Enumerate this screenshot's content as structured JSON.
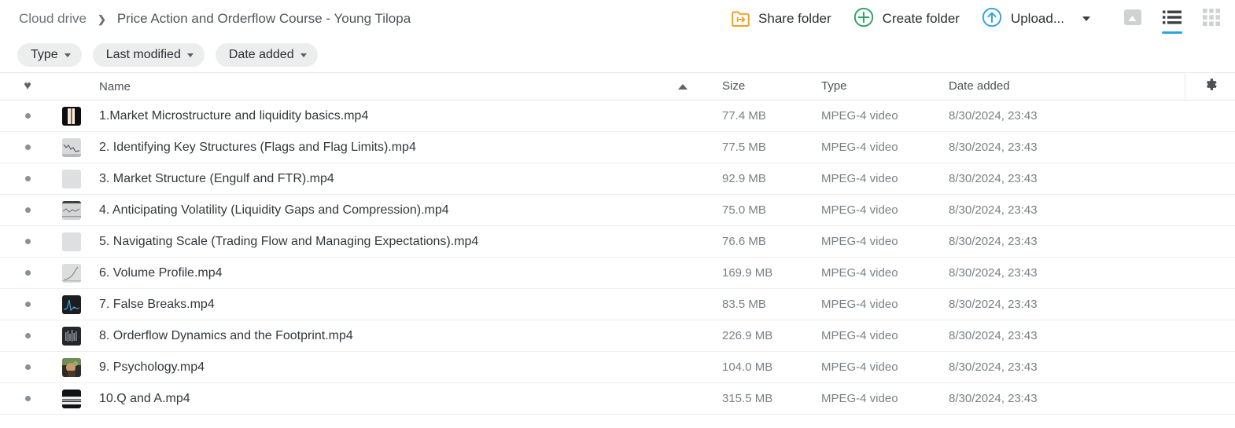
{
  "breadcrumb": {
    "root": "Cloud drive",
    "separator": "❯",
    "current": "Price Action and Orderflow Course - Young Tilopa"
  },
  "toolbar": {
    "share_folder_label": "Share folder",
    "create_folder_label": "Create folder",
    "upload_label": "Upload...",
    "icons": {
      "share": "share-folder-icon",
      "create": "plus-circle-icon",
      "upload": "upload-circle-icon",
      "dropdown": "chevron-down-icon"
    },
    "views": [
      {
        "name": "gallery-view",
        "active": false
      },
      {
        "name": "list-view",
        "active": true
      },
      {
        "name": "grid-view",
        "active": false
      }
    ],
    "accent_color": "#2aa3e6",
    "share_color": "#f6a01a",
    "create_color": "#27a55e"
  },
  "filters": [
    {
      "label": "Type"
    },
    {
      "label": "Last modified"
    },
    {
      "label": "Date added"
    }
  ],
  "table": {
    "headers": {
      "favorite": "♥",
      "name": "Name",
      "size": "Size",
      "type": "Type",
      "date_added": "Date added"
    },
    "sort": {
      "column": "Name",
      "direction": "asc"
    },
    "settings_icon": "gear-icon",
    "rows": [
      {
        "name": "1.Market Microstructure and liquidity basics.mp4",
        "size": "77.4 MB",
        "type": "MPEG-4 video",
        "date": "8/30/2024, 23:43",
        "thumb": "thumb-dark-bars"
      },
      {
        "name": "2. Identifying Key Structures (Flags and Flag Limits).mp4",
        "size": "77.5 MB",
        "type": "MPEG-4 video",
        "date": "8/30/2024, 23:43",
        "thumb": "thumb-chart-light"
      },
      {
        "name": "3. Market Structure (Engulf and FTR).mp4",
        "size": "92.9 MB",
        "type": "MPEG-4 video",
        "date": "8/30/2024, 23:43",
        "thumb": "thumb-blank-light"
      },
      {
        "name": "4. Anticipating Volatility (Liquidity Gaps and Compression).mp4",
        "size": "75.0 MB",
        "type": "MPEG-4 video",
        "date": "8/30/2024, 23:43",
        "thumb": "thumb-chart-grey"
      },
      {
        "name": "5. Navigating Scale (Trading Flow and Managing Expectations).mp4",
        "size": "76.6 MB",
        "type": "MPEG-4 video",
        "date": "8/30/2024, 23:43",
        "thumb": "thumb-blank-light"
      },
      {
        "name": "6. Volume Profile.mp4",
        "size": "169.9 MB",
        "type": "MPEG-4 video",
        "date": "8/30/2024, 23:43",
        "thumb": "thumb-curve-light"
      },
      {
        "name": "7. False Breaks.mp4",
        "size": "83.5 MB",
        "type": "MPEG-4 video",
        "date": "8/30/2024, 23:43",
        "thumb": "thumb-dark-spike"
      },
      {
        "name": "8. Orderflow Dynamics and the Footprint.mp4",
        "size": "226.9 MB",
        "type": "MPEG-4 video",
        "date": "8/30/2024, 23:43",
        "thumb": "thumb-dark-candles"
      },
      {
        "name": "9. Psychology.mp4",
        "size": "104.0 MB",
        "type": "MPEG-4 video",
        "date": "8/30/2024, 23:43",
        "thumb": "thumb-photo"
      },
      {
        "name": "10.Q and A.mp4",
        "size": "315.5 MB",
        "type": "MPEG-4 video",
        "date": "8/30/2024, 23:43",
        "thumb": "thumb-dark-stripe"
      }
    ]
  }
}
